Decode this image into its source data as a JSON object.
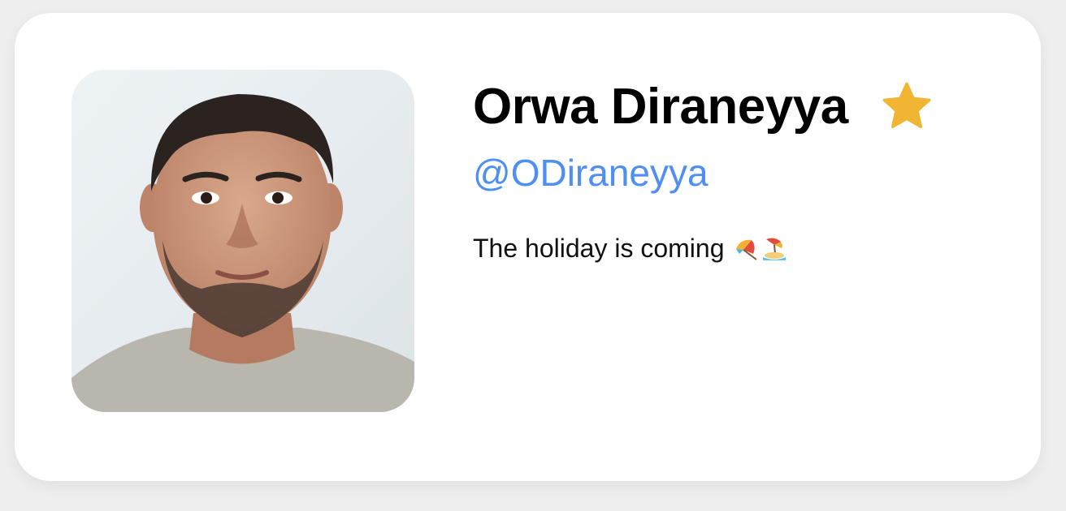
{
  "profile": {
    "name": "Orwa Diraneyya",
    "handle": "@ODiraneyya",
    "status_text": "The holiday is coming",
    "favorite": true
  },
  "icons": {
    "favorite": "star-icon",
    "status_emoji": [
      "beach-umbrella-icon",
      "beach-island-icon"
    ]
  },
  "colors": {
    "handle": "#4f8ef2",
    "star": "#f0b533",
    "card_background": "#ffffff",
    "page_background": "#eeeeee"
  }
}
